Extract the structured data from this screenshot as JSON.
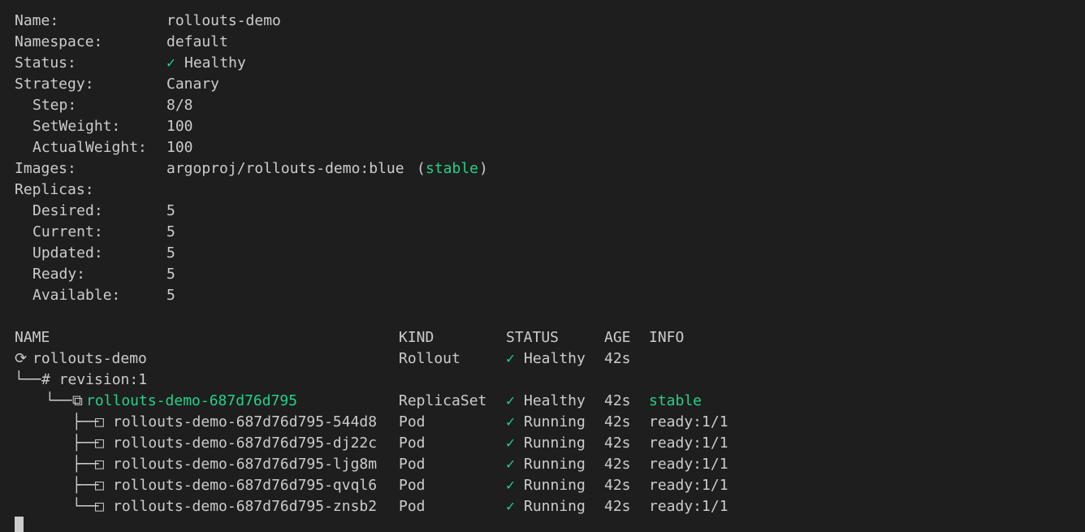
{
  "details": {
    "name": {
      "label": "Name:",
      "value": "rollouts-demo"
    },
    "namespace": {
      "label": "Namespace:",
      "value": "default"
    },
    "status": {
      "label": "Status:",
      "icon": "✓",
      "value": "Healthy"
    },
    "strategy": {
      "label": "Strategy:",
      "value": "Canary"
    },
    "step": {
      "label": "Step:",
      "value": "8/8"
    },
    "setweight": {
      "label": "SetWeight:",
      "value": "100"
    },
    "actualweight": {
      "label": "ActualWeight:",
      "value": "100"
    },
    "images": {
      "label": "Images:",
      "value": "argoproj/rollouts-demo:blue",
      "paren_open": "(",
      "tag": "stable",
      "paren_close": ")"
    },
    "replicas": {
      "label": "Replicas:"
    },
    "desired": {
      "label": "Desired:",
      "value": "5"
    },
    "current": {
      "label": "Current:",
      "value": "5"
    },
    "updated": {
      "label": "Updated:",
      "value": "5"
    },
    "ready": {
      "label": "Ready:",
      "value": "5"
    },
    "available": {
      "label": "Available:",
      "value": "5"
    }
  },
  "table": {
    "headers": {
      "name": "NAME",
      "kind": "KIND",
      "status": "STATUS",
      "age": "AGE",
      "info": "INFO"
    },
    "rollout": {
      "icon": "⟳",
      "name": "rollouts-demo",
      "kind": "Rollout",
      "check": "✓",
      "status": "Healthy",
      "age": "42s",
      "info": ""
    },
    "revision": {
      "prefix": "└──",
      "label": "# revision:1"
    },
    "replicaset": {
      "prefix": "└──",
      "icon": "⧉",
      "name": "rollouts-demo-687d76d795",
      "kind": "ReplicaSet",
      "check": "✓",
      "status": "Healthy",
      "age": "42s",
      "info": "stable"
    },
    "pods": [
      {
        "prefix": "├──",
        "icon": "□",
        "name": "rollouts-demo-687d76d795-544d8",
        "kind": "Pod",
        "check": "✓",
        "status": "Running",
        "age": "42s",
        "info": "ready:1/1"
      },
      {
        "prefix": "├──",
        "icon": "□",
        "name": "rollouts-demo-687d76d795-dj22c",
        "kind": "Pod",
        "check": "✓",
        "status": "Running",
        "age": "42s",
        "info": "ready:1/1"
      },
      {
        "prefix": "├──",
        "icon": "□",
        "name": "rollouts-demo-687d76d795-ljg8m",
        "kind": "Pod",
        "check": "✓",
        "status": "Running",
        "age": "42s",
        "info": "ready:1/1"
      },
      {
        "prefix": "├──",
        "icon": "□",
        "name": "rollouts-demo-687d76d795-qvql6",
        "kind": "Pod",
        "check": "✓",
        "status": "Running",
        "age": "42s",
        "info": "ready:1/1"
      },
      {
        "prefix": "└──",
        "icon": "□",
        "name": "rollouts-demo-687d76d795-znsb2",
        "kind": "Pod",
        "check": "✓",
        "status": "Running",
        "age": "42s",
        "info": "ready:1/1"
      }
    ]
  },
  "colors": {
    "background": "#1e1e1e",
    "text": "#cccccc",
    "accent_green": "#23d18b"
  }
}
